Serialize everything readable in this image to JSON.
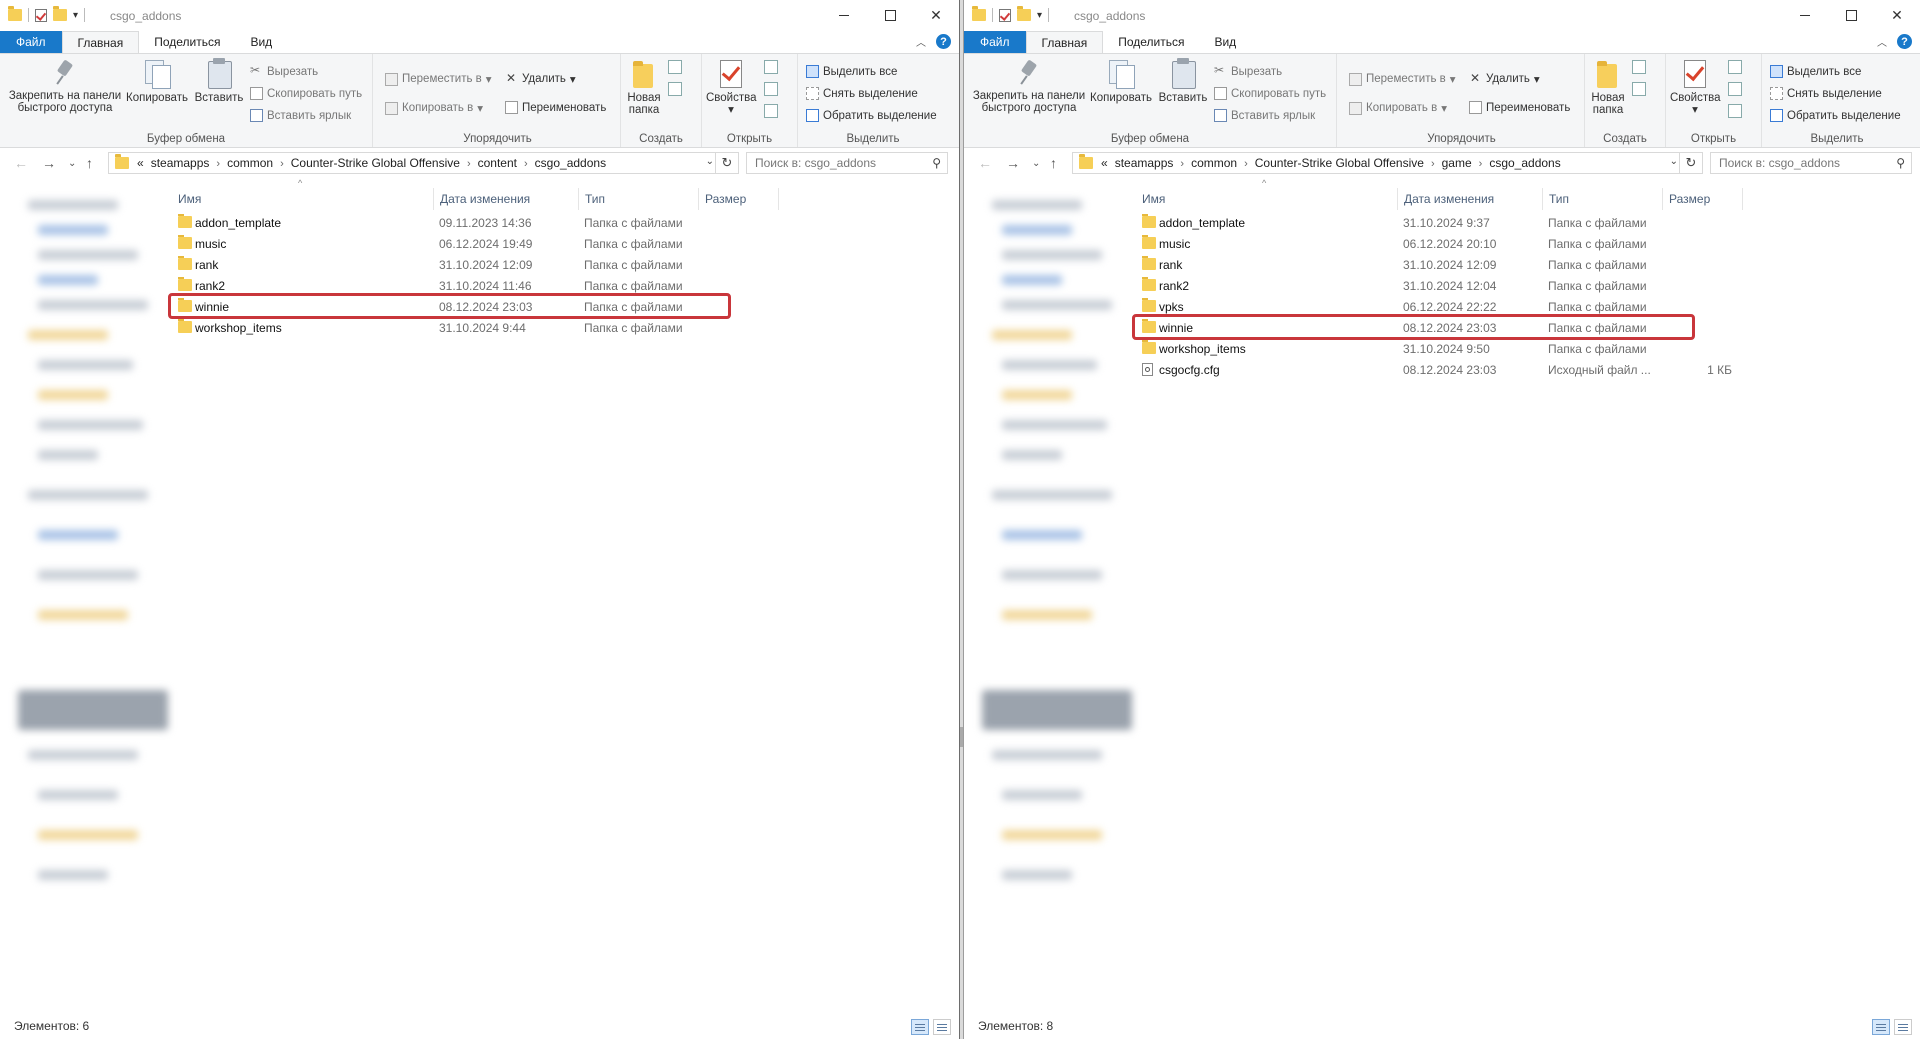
{
  "windows": [
    {
      "title": "csgo_addons",
      "tabs": {
        "file": "Файл",
        "home": "Главная",
        "share": "Поделиться",
        "view": "Вид"
      },
      "ribbon": {
        "pin": "Закрепить на панели быстрого доступа",
        "pin_line1": "Закрепить на панели",
        "pin_line2": "быстрого доступа",
        "copy": "Копировать",
        "paste": "Вставить",
        "cut": "Вырезать",
        "copy_path": "Скопировать путь",
        "paste_shortcut": "Вставить ярлык",
        "clipboard_group": "Буфер обмена",
        "move_to": "Переместить в",
        "copy_to": "Копировать в",
        "delete": "Удалить",
        "rename": "Переименовать",
        "organize_group": "Упорядочить",
        "new_folder_line1": "Новая",
        "new_folder_line2": "папка",
        "create_group": "Создать",
        "properties": "Свойства",
        "open_group": "Открыть",
        "select_all": "Выделить все",
        "select_none": "Снять выделение",
        "invert_selection": "Обратить выделение",
        "select_group": "Выделить"
      },
      "breadcrumb": [
        "steamapps",
        "common",
        "Counter-Strike Global Offensive",
        "content",
        "csgo_addons"
      ],
      "breadcrumb_prefix": "«",
      "search_placeholder": "Поиск в: csgo_addons",
      "columns": {
        "name": "Имя",
        "date": "Дата изменения",
        "type": "Тип",
        "size": "Размер"
      },
      "files": [
        {
          "name": "addon_template",
          "date": "09.11.2023 14:36",
          "type": "Папка с файлами",
          "size": "",
          "icon": "folder-icon"
        },
        {
          "name": "music",
          "date": "06.12.2024 19:49",
          "type": "Папка с файлами",
          "size": "",
          "icon": "folder-icon"
        },
        {
          "name": "rank",
          "date": "31.10.2024 12:09",
          "type": "Папка с файлами",
          "size": "",
          "icon": "folder-icon"
        },
        {
          "name": "rank2",
          "date": "31.10.2024 11:46",
          "type": "Папка с файлами",
          "size": "",
          "icon": "folder-icon"
        },
        {
          "name": "winnie",
          "date": "08.12.2024 23:03",
          "type": "Папка с файлами",
          "size": "",
          "icon": "folder-icon",
          "highlighted": true
        },
        {
          "name": "workshop_items",
          "date": "31.10.2024 9:44",
          "type": "Папка с файлами",
          "size": "",
          "icon": "folder-icon"
        }
      ],
      "status": "Элементов: 6"
    },
    {
      "title": "csgo_addons",
      "tabs": {
        "file": "Файл",
        "home": "Главная",
        "share": "Поделиться",
        "view": "Вид"
      },
      "ribbon": {
        "pin": "Закрепить на панели быстрого доступа",
        "pin_line1": "Закрепить на панели",
        "pin_line2": "быстрого доступа",
        "copy": "Копировать",
        "paste": "Вставить",
        "cut": "Вырезать",
        "copy_path": "Скопировать путь",
        "paste_shortcut": "Вставить ярлык",
        "clipboard_group": "Буфер обмена",
        "move_to": "Переместить в",
        "copy_to": "Копировать в",
        "delete": "Удалить",
        "rename": "Переименовать",
        "organize_group": "Упорядочить",
        "new_folder_line1": "Новая",
        "new_folder_line2": "папка",
        "create_group": "Создать",
        "properties": "Свойства",
        "open_group": "Открыть",
        "select_all": "Выделить все",
        "select_none": "Снять выделение",
        "invert_selection": "Обратить выделение",
        "select_group": "Выделить"
      },
      "breadcrumb": [
        "steamapps",
        "common",
        "Counter-Strike Global Offensive",
        "game",
        "csgo_addons"
      ],
      "breadcrumb_prefix": "«",
      "search_placeholder": "Поиск в: csgo_addons",
      "columns": {
        "name": "Имя",
        "date": "Дата изменения",
        "type": "Тип",
        "size": "Размер"
      },
      "files": [
        {
          "name": "addon_template",
          "date": "31.10.2024 9:37",
          "type": "Папка с файлами",
          "size": "",
          "icon": "folder-icon"
        },
        {
          "name": "music",
          "date": "06.12.2024 20:10",
          "type": "Папка с файлами",
          "size": "",
          "icon": "folder-icon"
        },
        {
          "name": "rank",
          "date": "31.10.2024 12:09",
          "type": "Папка с файлами",
          "size": "",
          "icon": "folder-icon"
        },
        {
          "name": "rank2",
          "date": "31.10.2024 12:04",
          "type": "Папка с файлами",
          "size": "",
          "icon": "folder-icon"
        },
        {
          "name": "vpks",
          "date": "06.12.2024 22:22",
          "type": "Папка с файлами",
          "size": "",
          "icon": "folder-icon"
        },
        {
          "name": "winnie",
          "date": "08.12.2024 23:03",
          "type": "Папка с файлами",
          "size": "",
          "icon": "folder-icon",
          "highlighted": true
        },
        {
          "name": "workshop_items",
          "date": "31.10.2024 9:50",
          "type": "Папка с файлами",
          "size": "",
          "icon": "folder-icon"
        },
        {
          "name": "csgocfg.cfg",
          "date": "08.12.2024 23:03",
          "type": "Исходный файл ...",
          "size": "1 КБ",
          "icon": "cfg-file-icon"
        }
      ],
      "status": "Элементов: 8"
    }
  ],
  "colors": {
    "file_tab": "#1979ca",
    "highlight_box": "#c9363b",
    "folder": "#f6cf57"
  }
}
